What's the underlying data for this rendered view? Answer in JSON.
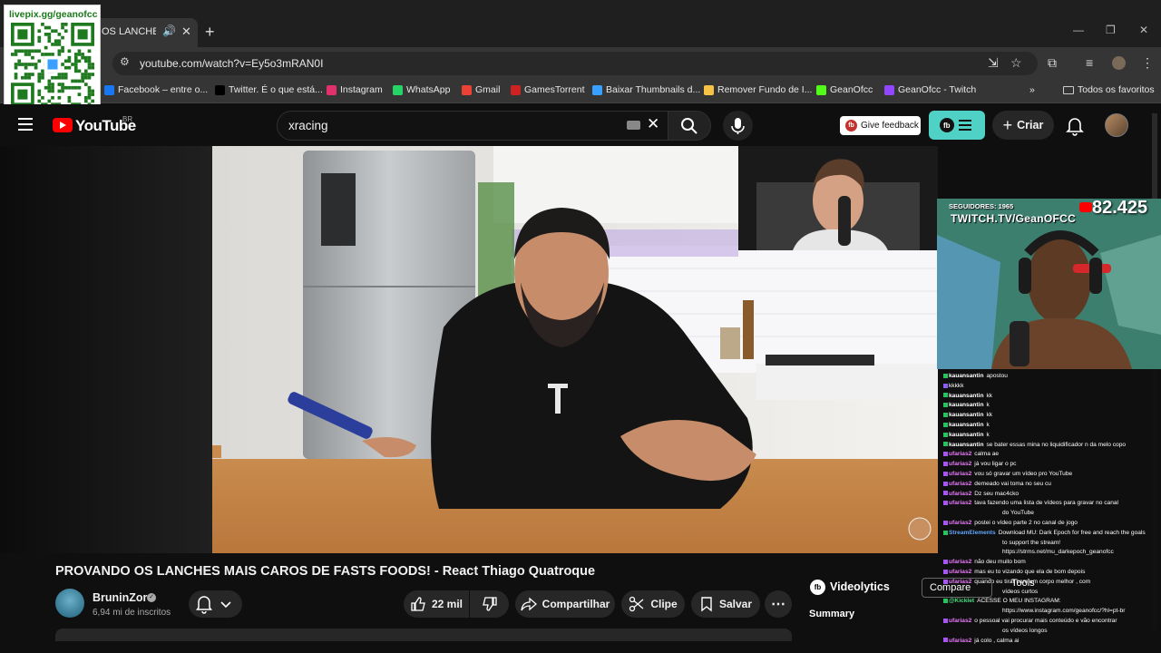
{
  "qr_overlay": {
    "label": "livepix.gg/geanofcc"
  },
  "browser": {
    "tab_title": "OS LANCHES M",
    "url": "youtube.com/watch?v=Ey5o3mRAN0I",
    "bookmarks": [
      {
        "label": "Facebook – entre o...",
        "icon": "facebook-icon",
        "color": "#1877f2"
      },
      {
        "label": "Twitter. É o que está...",
        "icon": "x-icon",
        "color": "#000000"
      },
      {
        "label": "Instagram",
        "icon": "instagram-icon",
        "color": "#e1306c"
      },
      {
        "label": "WhatsApp",
        "icon": "whatsapp-icon",
        "color": "#25d366"
      },
      {
        "label": "Gmail",
        "icon": "gmail-icon",
        "color": "#ea4335"
      },
      {
        "label": "GamesTorrent",
        "icon": "gamestorrent-icon",
        "color": "#cc2222"
      },
      {
        "label": "Baixar Thumbnails d...",
        "icon": "thumbnail-icon",
        "color": "#3aa0ff"
      },
      {
        "label": "Remover Fundo de I...",
        "icon": "removebg-icon",
        "color": "#f6c344"
      },
      {
        "label": "GeanOfcc",
        "icon": "kick-icon",
        "color": "#53fc18"
      },
      {
        "label": "GeanOfcc - Twitch",
        "icon": "twitch-icon",
        "color": "#9146ff"
      }
    ],
    "all_favorites": "Todos os favoritos"
  },
  "youtube": {
    "logo_text": "YouTube",
    "region": "BR",
    "search_query": "xracing",
    "feedback_label": "Give feedback",
    "create_label": "Criar"
  },
  "video": {
    "title": "PROVANDO OS LANCHES MAIS CAROS DE FASTS FOODS! - React Thiago Quatroque",
    "channel": "BruninZor",
    "subscribers": "6,94 mi de inscritos",
    "likes": "22 mil",
    "share_label": "Compartilhar",
    "clip_label": "Clipe",
    "save_label": "Salvar"
  },
  "videolytics": {
    "title": "Videolytics",
    "compare_label": "Compare",
    "tools_label": "Tools",
    "summary_label": "Summary"
  },
  "stream_overlay": {
    "followers_text": "SEGUIDORES: 1965",
    "twitch_url": "TWITCH.TV/GeanOFCC",
    "sub_count": "82.425"
  },
  "chat": [
    {
      "user": "kauansantin",
      "text": "apostou",
      "color": "#ffffff",
      "badge": "#22c55e"
    },
    {
      "user": "",
      "text": "kkkkk",
      "color": "#ff3b3b",
      "badge": "#8b5cf6"
    },
    {
      "user": "kauansantin",
      "text": "kk",
      "color": "#ffffff",
      "badge": "#22c55e"
    },
    {
      "user": "kauansantin",
      "text": "k",
      "color": "#ffffff",
      "badge": "#22c55e"
    },
    {
      "user": "kauansantin",
      "text": "kk",
      "color": "#ffffff",
      "badge": "#22c55e"
    },
    {
      "user": "kauansantin",
      "text": "k",
      "color": "#ffffff",
      "badge": "#22c55e"
    },
    {
      "user": "kauansantin",
      "text": "k",
      "color": "#ffffff",
      "badge": "#22c55e"
    },
    {
      "user": "kauansantin",
      "text": "se bater essas mina no liquidificador n da melo copo",
      "color": "#ffffff",
      "badge": "#22c55e"
    },
    {
      "user": "ufarias2",
      "text": "calma ae",
      "color": "#e879f9",
      "badge": "#a855f7"
    },
    {
      "user": "ufarias2",
      "text": "já vou ligar o pc",
      "color": "#e879f9",
      "badge": "#a855f7"
    },
    {
      "user": "ufarias2",
      "text": "vou só gravar um vídeo pro YouTube",
      "color": "#e879f9",
      "badge": "#a855f7"
    },
    {
      "user": "ufarias2",
      "text": "demeado vai toma no seu cu",
      "color": "#e879f9",
      "badge": "#a855f7"
    },
    {
      "user": "ufarias2",
      "text": "Dz seu mac4cko",
      "color": "#e879f9",
      "badge": "#a855f7"
    },
    {
      "user": "ufarias2",
      "text": "tava fazendo uma lista de vídeos para gravar no canal",
      "color": "#e879f9",
      "badge": "#a855f7"
    },
    {
      "user": "",
      "text": "do YouTube",
      "color": "#e879f9",
      "badge": ""
    },
    {
      "user": "ufarias2",
      "text": "postei o vídeo parte 2 no canal de jogo",
      "color": "#e879f9",
      "badge": "#a855f7"
    },
    {
      "user": "StreamElements",
      "text": "Download MU: Dark Epoch for free and reach the goals",
      "color": "#60a5fa",
      "badge": "#22c55e"
    },
    {
      "user": "",
      "text": "to support the stream!",
      "color": "#60a5fa",
      "badge": ""
    },
    {
      "user": "",
      "text": "https://strms.net/mu_darkepoch_geanofcc",
      "color": "#60a5fa",
      "badge": ""
    },
    {
      "user": "ufarias2",
      "text": "não deu muito bom",
      "color": "#e879f9",
      "badge": "#a855f7"
    },
    {
      "user": "ufarias2",
      "text": "mas eu to vizando que ela de bom depois",
      "color": "#e879f9",
      "badge": "#a855f7"
    },
    {
      "user": "ufarias2",
      "text": "quando eu tirar com um corpo melhor , com",
      "color": "#e879f9",
      "badge": "#a855f7"
    },
    {
      "user": "",
      "text": "vídeos curtos",
      "color": "#e879f9",
      "badge": ""
    },
    {
      "user": "@Kicklet",
      "text": "ACESSE O MEU INSTAGRAM:",
      "color": "#4ade80",
      "badge": "#22c55e"
    },
    {
      "user": "",
      "text": "https://www.instagram.com/geanofcc/?hl=pt-br",
      "color": "#4ade80",
      "badge": ""
    },
    {
      "user": "ufarias2",
      "text": "o pessoal vai procurar mais conteúdo e vão encontrar",
      "color": "#e879f9",
      "badge": "#a855f7"
    },
    {
      "user": "",
      "text": "os vídeos longos",
      "color": "#e879f9",
      "badge": ""
    },
    {
      "user": "ufarias2",
      "text": "já colo , calma ai",
      "color": "#e879f9",
      "badge": "#a855f7"
    }
  ]
}
